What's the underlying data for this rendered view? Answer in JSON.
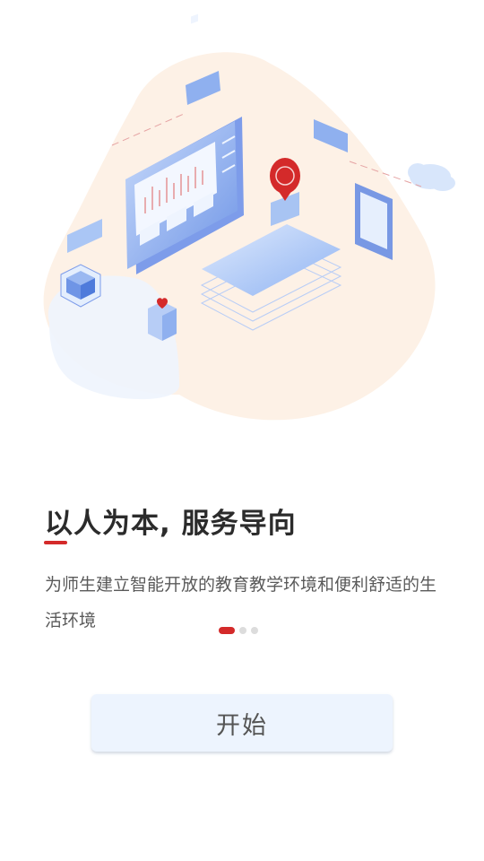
{
  "onboarding": {
    "title": "以人为本, 服务导向",
    "description": "为师生建立智能开放的教育教学环境和便利舒适的生活环境",
    "pager": {
      "total": 3,
      "active_index": 0
    },
    "start_label": "开始"
  },
  "colors": {
    "accent": "#d42a2a",
    "button_bg": "#edf4fe",
    "blob": "#fdf1e6",
    "illustration_blue": "#6f95e6"
  }
}
